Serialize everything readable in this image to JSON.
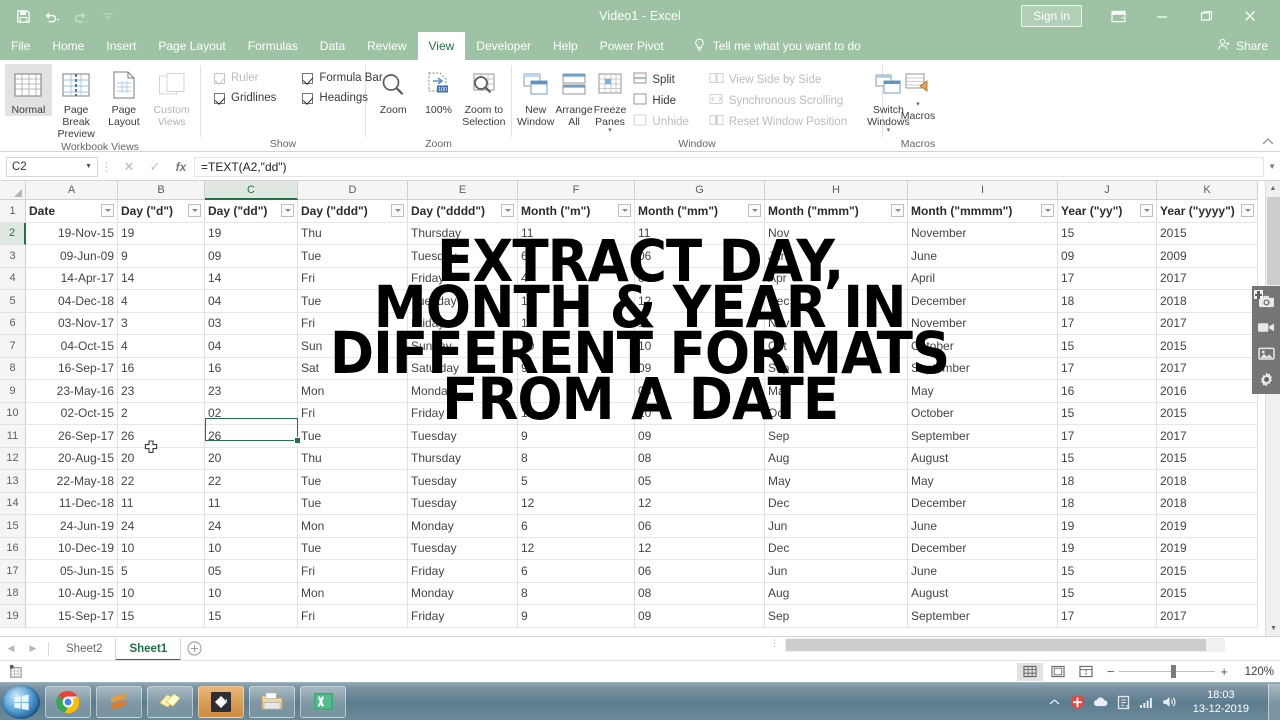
{
  "titlebar": {
    "title": "Video1  -  Excel",
    "signin": "Sign in",
    "qat": [
      "save-icon",
      "undo-icon",
      "redo-icon",
      "customize-qat-icon"
    ],
    "window_buttons": [
      "ribbon-display-options-icon",
      "minimize-icon",
      "restore-icon",
      "close-icon"
    ]
  },
  "ribbon": {
    "tabs": [
      {
        "label": "File",
        "active": false
      },
      {
        "label": "Home",
        "active": false
      },
      {
        "label": "Insert",
        "active": false
      },
      {
        "label": "Page Layout",
        "active": false
      },
      {
        "label": "Formulas",
        "active": false
      },
      {
        "label": "Data",
        "active": false
      },
      {
        "label": "Review",
        "active": false
      },
      {
        "label": "View",
        "active": true
      },
      {
        "label": "Developer",
        "active": false
      },
      {
        "label": "Help",
        "active": false
      },
      {
        "label": "Power Pivot",
        "active": false
      }
    ],
    "tellme": "Tell me what you want to do",
    "share": "Share",
    "groups": {
      "workbook_views": {
        "label": "Workbook Views",
        "buttons": [
          {
            "label": "Normal",
            "selected": true,
            "disabled": false
          },
          {
            "label": "Page Break Preview",
            "selected": false,
            "disabled": false
          },
          {
            "label": "Page Layout",
            "selected": false,
            "disabled": false
          },
          {
            "label": "Custom Views",
            "selected": false,
            "disabled": true
          }
        ]
      },
      "show": {
        "label": "Show",
        "checks": [
          {
            "label": "Ruler",
            "checked": true,
            "disabled": true
          },
          {
            "label": "Formula Bar",
            "checked": true,
            "disabled": false
          },
          {
            "label": "Gridlines",
            "checked": true,
            "disabled": false
          },
          {
            "label": "Headings",
            "checked": true,
            "disabled": false
          }
        ]
      },
      "zoom": {
        "label": "Zoom",
        "buttons": [
          {
            "label": "Zoom",
            "disabled": false
          },
          {
            "label": "100%",
            "disabled": false
          },
          {
            "label": "Zoom to Selection",
            "disabled": false
          }
        ]
      },
      "window": {
        "label": "Window",
        "buttons": [
          {
            "label": "New Window",
            "disabled": false
          },
          {
            "label": "Arrange All",
            "disabled": false
          },
          {
            "label": "Freeze Panes",
            "disabled": false,
            "dropdown": true
          },
          {
            "label": "Switch Windows",
            "disabled": false,
            "dropdown": true
          }
        ],
        "small": [
          {
            "label": "Split",
            "disabled": false
          },
          {
            "label": "Hide",
            "disabled": false
          },
          {
            "label": "Unhide",
            "disabled": true
          },
          {
            "label": "View Side by Side",
            "disabled": true
          },
          {
            "label": "Synchronous Scrolling",
            "disabled": true
          },
          {
            "label": "Reset Window Position",
            "disabled": true
          }
        ]
      },
      "macros": {
        "label": "Macros",
        "buttons": [
          {
            "label": "Macros",
            "disabled": false,
            "dropdown": true
          }
        ]
      }
    }
  },
  "formula_bar": {
    "name_box": "C2",
    "formula": "=TEXT(A2,\"dd\")",
    "cancel_icon": "close-icon",
    "enter_icon": "check-icon",
    "fx_icon": "insert-function-icon"
  },
  "grid": {
    "columns": [
      "A",
      "B",
      "C",
      "D",
      "E",
      "F",
      "G",
      "H",
      "I",
      "J",
      "K"
    ],
    "selected_column": "C",
    "selected_row": 2,
    "selected_cell": "C2",
    "headers": [
      "Date",
      "Day (\"d\")",
      "Day (\"dd\")",
      "Day (\"ddd\")",
      "Day (\"dddd\")",
      "Month (\"m\")",
      "Month (\"mm\")",
      "Month (\"mmm\")",
      "Month (\"mmmm\")",
      "Year (\"yy\")",
      "Year (\"yyyy\")"
    ],
    "rows": [
      [
        "19-Nov-15",
        "19",
        "19",
        "Thu",
        "Thursday",
        "11",
        "11",
        "Nov",
        "November",
        "15",
        "2015"
      ],
      [
        "09-Jun-09",
        "9",
        "09",
        "Tue",
        "Tuesday",
        "6",
        "06",
        "Jun",
        "June",
        "09",
        "2009"
      ],
      [
        "14-Apr-17",
        "14",
        "14",
        "Fri",
        "Friday",
        "4",
        "04",
        "Apr",
        "April",
        "17",
        "2017"
      ],
      [
        "04-Dec-18",
        "4",
        "04",
        "Tue",
        "Tuesday",
        "12",
        "12",
        "Dec",
        "December",
        "18",
        "2018"
      ],
      [
        "03-Nov-17",
        "3",
        "03",
        "Fri",
        "Friday",
        "11",
        "11",
        "Nov",
        "November",
        "17",
        "2017"
      ],
      [
        "04-Oct-15",
        "4",
        "04",
        "Sun",
        "Sunday",
        "10",
        "10",
        "Oct",
        "October",
        "15",
        "2015"
      ],
      [
        "16-Sep-17",
        "16",
        "16",
        "Sat",
        "Saturday",
        "9",
        "09",
        "Sep",
        "September",
        "17",
        "2017"
      ],
      [
        "23-May-16",
        "23",
        "23",
        "Mon",
        "Monday",
        "5",
        "05",
        "May",
        "May",
        "16",
        "2016"
      ],
      [
        "02-Oct-15",
        "2",
        "02",
        "Fri",
        "Friday",
        "10",
        "10",
        "Oct",
        "October",
        "15",
        "2015"
      ],
      [
        "26-Sep-17",
        "26",
        "26",
        "Tue",
        "Tuesday",
        "9",
        "09",
        "Sep",
        "September",
        "17",
        "2017"
      ],
      [
        "20-Aug-15",
        "20",
        "20",
        "Thu",
        "Thursday",
        "8",
        "08",
        "Aug",
        "August",
        "15",
        "2015"
      ],
      [
        "22-May-18",
        "22",
        "22",
        "Tue",
        "Tuesday",
        "5",
        "05",
        "May",
        "May",
        "18",
        "2018"
      ],
      [
        "11-Dec-18",
        "11",
        "11",
        "Tue",
        "Tuesday",
        "12",
        "12",
        "Dec",
        "December",
        "18",
        "2018"
      ],
      [
        "24-Jun-19",
        "24",
        "24",
        "Mon",
        "Monday",
        "6",
        "06",
        "Jun",
        "June",
        "19",
        "2019"
      ],
      [
        "10-Dec-19",
        "10",
        "10",
        "Tue",
        "Tuesday",
        "12",
        "12",
        "Dec",
        "December",
        "19",
        "2019"
      ],
      [
        "05-Jun-15",
        "5",
        "05",
        "Fri",
        "Friday",
        "6",
        "06",
        "Jun",
        "June",
        "15",
        "2015"
      ],
      [
        "10-Aug-15",
        "10",
        "10",
        "Mon",
        "Monday",
        "8",
        "08",
        "Aug",
        "August",
        "15",
        "2015"
      ],
      [
        "15-Sep-17",
        "15",
        "15",
        "Fri",
        "Friday",
        "9",
        "09",
        "Sep",
        "September",
        "17",
        "2017"
      ]
    ],
    "row_numbers": [
      "1",
      "2",
      "3",
      "4",
      "5",
      "6",
      "7",
      "8",
      "9",
      "10",
      "11",
      "12",
      "13",
      "14",
      "15",
      "16",
      "17",
      "18",
      "19"
    ]
  },
  "sheet_tabs": {
    "tabs": [
      {
        "label": "Sheet2",
        "active": false
      },
      {
        "label": "Sheet1",
        "active": true
      }
    ],
    "add_label": "+"
  },
  "status_bar": {
    "macro_icon": "record-macro-icon",
    "views": [
      {
        "name": "normal-view",
        "active": true
      },
      {
        "name": "page-layout-view",
        "active": false
      },
      {
        "name": "page-break-preview-view",
        "active": false
      }
    ],
    "zoom_out": "−",
    "zoom_in": "+",
    "zoom_level": "120%"
  },
  "taskbar": {
    "start": "start-orb-icon",
    "items": [
      "chrome-icon",
      "sublime-text-icon",
      "sticky-notes-icon",
      "screen-recorder-icon",
      "file-explorer-icon",
      "excel-icon"
    ],
    "tray": [
      "show-hidden-icons-icon",
      "security-shield-icon",
      "cloud-icon",
      "action-center-icon",
      "network-icon",
      "volume-icon"
    ],
    "time": "18:03",
    "date": "13-12-2019"
  },
  "recorder_overlay": {
    "icons": [
      "pin-icon",
      "camera-icon",
      "video-camera-icon",
      "image-icon",
      "gear-icon"
    ]
  },
  "overlay_text": {
    "lines": [
      "EXTRACT DAY,",
      "MONTH & YEAR IN",
      "DIFFERENT FORMATS",
      "FROM A DATE"
    ]
  },
  "colors": {
    "excel_green": "#217346",
    "titlebar_green": "#9ec3a4",
    "grid_line": "#e0e0e0"
  }
}
